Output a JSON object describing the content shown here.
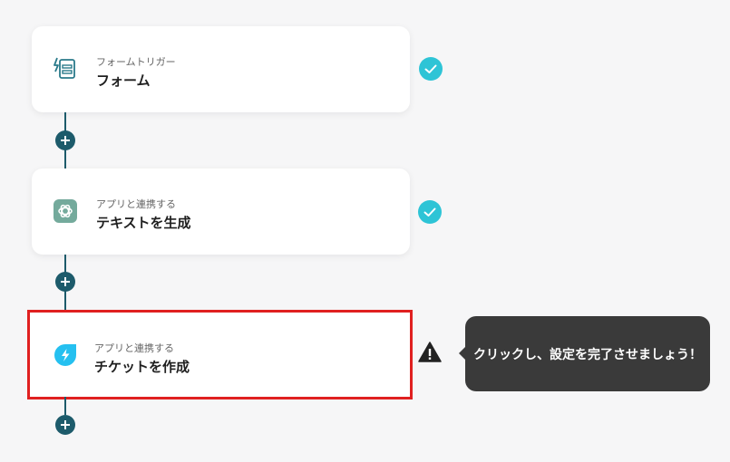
{
  "steps": [
    {
      "subtitle": "フォームトリガー",
      "title": "フォーム",
      "icon": "form-trigger-icon",
      "status": "complete"
    },
    {
      "subtitle": "アプリと連携する",
      "title": "テキストを生成",
      "icon": "openai-icon",
      "status": "complete"
    },
    {
      "subtitle": "アプリと連携する",
      "title": "チケットを作成",
      "icon": "freshdesk-icon",
      "status": "warning"
    }
  ],
  "tooltip": {
    "text": "クリックし、設定を完了させましょう！"
  },
  "colors": {
    "connector": "#1d5b6b",
    "check": "#2ec4d6",
    "highlight": "#e02020",
    "tooltip_bg": "#3a3a3a",
    "form_icon": "#2a7a8a",
    "openai_icon": "#74aa9c",
    "freshdesk_icon": "#25c0f0"
  }
}
